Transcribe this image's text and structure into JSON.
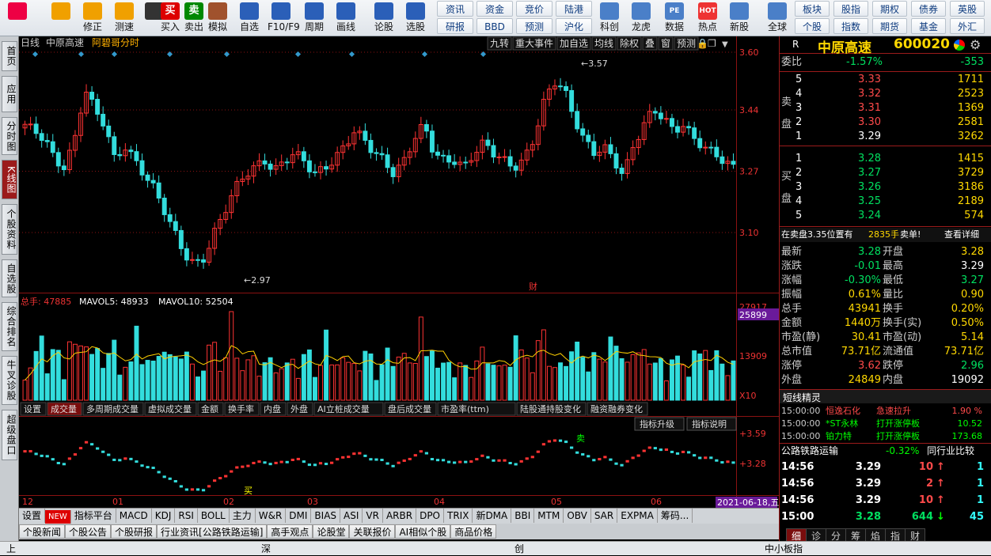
{
  "toolbar": {
    "big": [
      {
        "label": "",
        "icon": "grid-app-icon",
        "color": "#e04"
      },
      {
        "label": "",
        "icon": "back-arrow-icon",
        "color": "#f0a000"
      },
      {
        "label": "修正",
        "icon": "up-arrow-icon",
        "color": "#f0a000"
      },
      {
        "label": "测速",
        "icon": "power-icon",
        "color": "#f0a000"
      },
      {
        "label": "",
        "icon": "clock-icon",
        "color": "#333"
      },
      {
        "label": "买入",
        "icon": "buy-icon",
        "glyph": "买",
        "color": "#d00"
      },
      {
        "label": "卖出",
        "icon": "sell-icon",
        "glyph": "卖",
        "color": "#080"
      },
      {
        "label": "模拟",
        "icon": "hammer-icon",
        "color": "#a0522d"
      },
      {
        "label": "自选",
        "icon": "star-icon",
        "color": "#2b5fb8"
      },
      {
        "label": "F10/F9",
        "icon": "doc-icon",
        "color": "#2b5fb8"
      },
      {
        "label": "周期",
        "icon": "period-icon",
        "color": "#2b5fb8"
      },
      {
        "label": "画线",
        "icon": "pen-icon",
        "color": "#2b5fb8"
      },
      {
        "label": "论股",
        "icon": "forum-icon",
        "color": "#2b5fb8"
      },
      {
        "label": "选股",
        "icon": "select-icon",
        "color": "#2b5fb8"
      }
    ],
    "small_top": [
      "资讯",
      "资金",
      "竞价",
      "陆港"
    ],
    "small_bottom": [
      "研报",
      "BBD",
      "预测",
      "沪化"
    ],
    "big2": [
      {
        "label": "科创",
        "icon": "chart-icon"
      },
      {
        "label": "龙虎",
        "icon": "tiger-icon"
      },
      {
        "label": "数据",
        "icon": "pe-icon",
        "glyph": "PE"
      },
      {
        "label": "热点",
        "icon": "hot-icon",
        "glyph": "HOT"
      },
      {
        "label": "新股",
        "icon": "newstock-icon"
      },
      {
        "label": "全球",
        "icon": "globe-icon"
      }
    ],
    "small2_top": [
      "板块",
      "股指",
      "期权",
      "债券",
      "英股"
    ],
    "small2_bottom": [
      "个股",
      "指数",
      "期货",
      "基金",
      "外汇"
    ]
  },
  "sidetabs": [
    "首页",
    "应用",
    "分时图",
    "K线图",
    "个股资料",
    "自选股",
    "综合排名",
    "牛叉诊股",
    "超级盘口"
  ],
  "chart": {
    "header_left": [
      "日线",
      "中原高速",
      "阿碧哥分时"
    ],
    "header_right": [
      "九转",
      "重大事件",
      "加自选",
      "均线",
      "除权",
      "叠",
      "窗",
      "预测"
    ],
    "price_ticks": [
      "3.60",
      "3.44",
      "3.27",
      "3.10"
    ],
    "hi_label": "3.57",
    "lo_label": "2.97",
    "fin_label": "财",
    "vol_header": {
      "total": "总手: 47885",
      "mav5": "MAVOL5: 48933",
      "mav10": "MAVOL10: 52504"
    },
    "vol_ticks": [
      "27917",
      "13909",
      "X10"
    ],
    "vol_current": "25899",
    "vol_tabs": [
      "设置",
      "成交量",
      "多周期成交量",
      "虚拟成交量",
      "金额",
      "换手率",
      "内盘",
      "外盘",
      "AI立桩成交量",
      "盘后成交量",
      "市盈率(ttm)",
      "陆股通持股变化",
      "融资融券变化"
    ],
    "ind_buttons": [
      "指标升级",
      "指标说明"
    ],
    "ind_ticks": [
      "+3.59",
      "+3.28"
    ],
    "ind_marks": [
      "卖",
      "买"
    ],
    "months": [
      "12",
      "01",
      "02",
      "03",
      "04",
      "05",
      "06"
    ],
    "date_label": "2021-06-18,五"
  },
  "bottom_tabs": [
    "设置",
    "NEW",
    "指标平台",
    "MACD",
    "KDJ",
    "RSI",
    "BOLL",
    "主力",
    "W&R",
    "DMI",
    "BIAS",
    "ASI",
    "VR",
    "ARBR",
    "DPO",
    "TRIX",
    "新DMA",
    "BBI",
    "MTM",
    "OBV",
    "SAR",
    "EXPMA",
    "筹码..."
  ],
  "info_tabs": [
    "个股新闻",
    "个股公告",
    "个股研报",
    "行业资讯[公路铁路运输]",
    "高手观点",
    "论股堂",
    "关联报价",
    "AI相似个股",
    "商品价格"
  ],
  "status": {
    "a": "上",
    "b": "深",
    "c": "创",
    "d": "中小板指"
  },
  "quote": {
    "r": "R",
    "name": "中原高速",
    "code": "600020",
    "weibi": {
      "label": "委比",
      "pct": "-1.57%",
      "val": "-353"
    },
    "sell": [
      {
        "n": "5",
        "p": "3.33",
        "v": "1711"
      },
      {
        "n": "4",
        "p": "3.32",
        "v": "2523"
      },
      {
        "n": "3",
        "p": "3.31",
        "v": "1369"
      },
      {
        "n": "2",
        "p": "3.30",
        "v": "2581"
      },
      {
        "n": "1",
        "p": "3.29",
        "v": "3262"
      }
    ],
    "buy": [
      {
        "n": "1",
        "p": "3.28",
        "v": "1415"
      },
      {
        "n": "2",
        "p": "3.27",
        "v": "3729"
      },
      {
        "n": "3",
        "p": "3.26",
        "v": "3186"
      },
      {
        "n": "4",
        "p": "3.25",
        "v": "2189"
      },
      {
        "n": "5",
        "p": "3.24",
        "v": "574"
      }
    ],
    "sell_label": "卖盘",
    "buy_label": "买盘",
    "notice": {
      "text": "在卖盘3.35位置有",
      "vol": "2835手",
      "act": "卖单!",
      "link": "查看详细"
    },
    "stats": [
      [
        "最新",
        "3.28",
        "开盘",
        "3.28"
      ],
      [
        "涨跌",
        "-0.01",
        "最高",
        "3.29"
      ],
      [
        "涨幅",
        "-0.30%",
        "最低",
        "3.27"
      ],
      [
        "振幅",
        "0.61%",
        "量比",
        "0.90"
      ],
      [
        "总手",
        "43941",
        "换手",
        "0.20%"
      ],
      [
        "金额",
        "1440万",
        "换手(实)",
        "0.50%"
      ],
      [
        "市盈(静)",
        "30.41",
        "市盈(动)",
        "5.14"
      ],
      [
        "总市值",
        "73.71亿",
        "流通值",
        "73.71亿"
      ],
      [
        "涨停",
        "3.62",
        "跌停",
        "2.96"
      ],
      [
        "外盘",
        "24849",
        "内盘",
        "19092"
      ]
    ],
    "short_title": "短线精灵",
    "short": [
      {
        "t": "15:00:00",
        "n": "恒逸石化",
        "e": "急速拉升",
        "v": "1.90 %"
      },
      {
        "t": "15:00:00",
        "n": "*ST永林",
        "e": "打开涨停板",
        "v": "10.52"
      },
      {
        "t": "15:00:00",
        "n": "铂力特",
        "e": "打开涨停板",
        "v": "173.68"
      }
    ],
    "industry": {
      "name": "公路铁路运输",
      "pct": "-0.32%",
      "btn": "同行业比较"
    },
    "ticks": [
      {
        "t": "14:56",
        "p": "3.29",
        "v": "10",
        "d": "up",
        "c": "1"
      },
      {
        "t": "14:56",
        "p": "3.29",
        "v": "2",
        "d": "up",
        "c": "1"
      },
      {
        "t": "14:56",
        "p": "3.29",
        "v": "10",
        "d": "up",
        "c": "1"
      },
      {
        "t": "15:00",
        "p": "3.28",
        "v": "644",
        "d": "down",
        "c": "45"
      }
    ],
    "bottom_tabs": [
      "细",
      "诊",
      "分",
      "筹",
      "焰",
      "指",
      "财"
    ]
  },
  "colors": {
    "up": "#ff3333",
    "down": "#33dddd",
    "ma": "#ffd000",
    "grid": "#8b1212"
  }
}
